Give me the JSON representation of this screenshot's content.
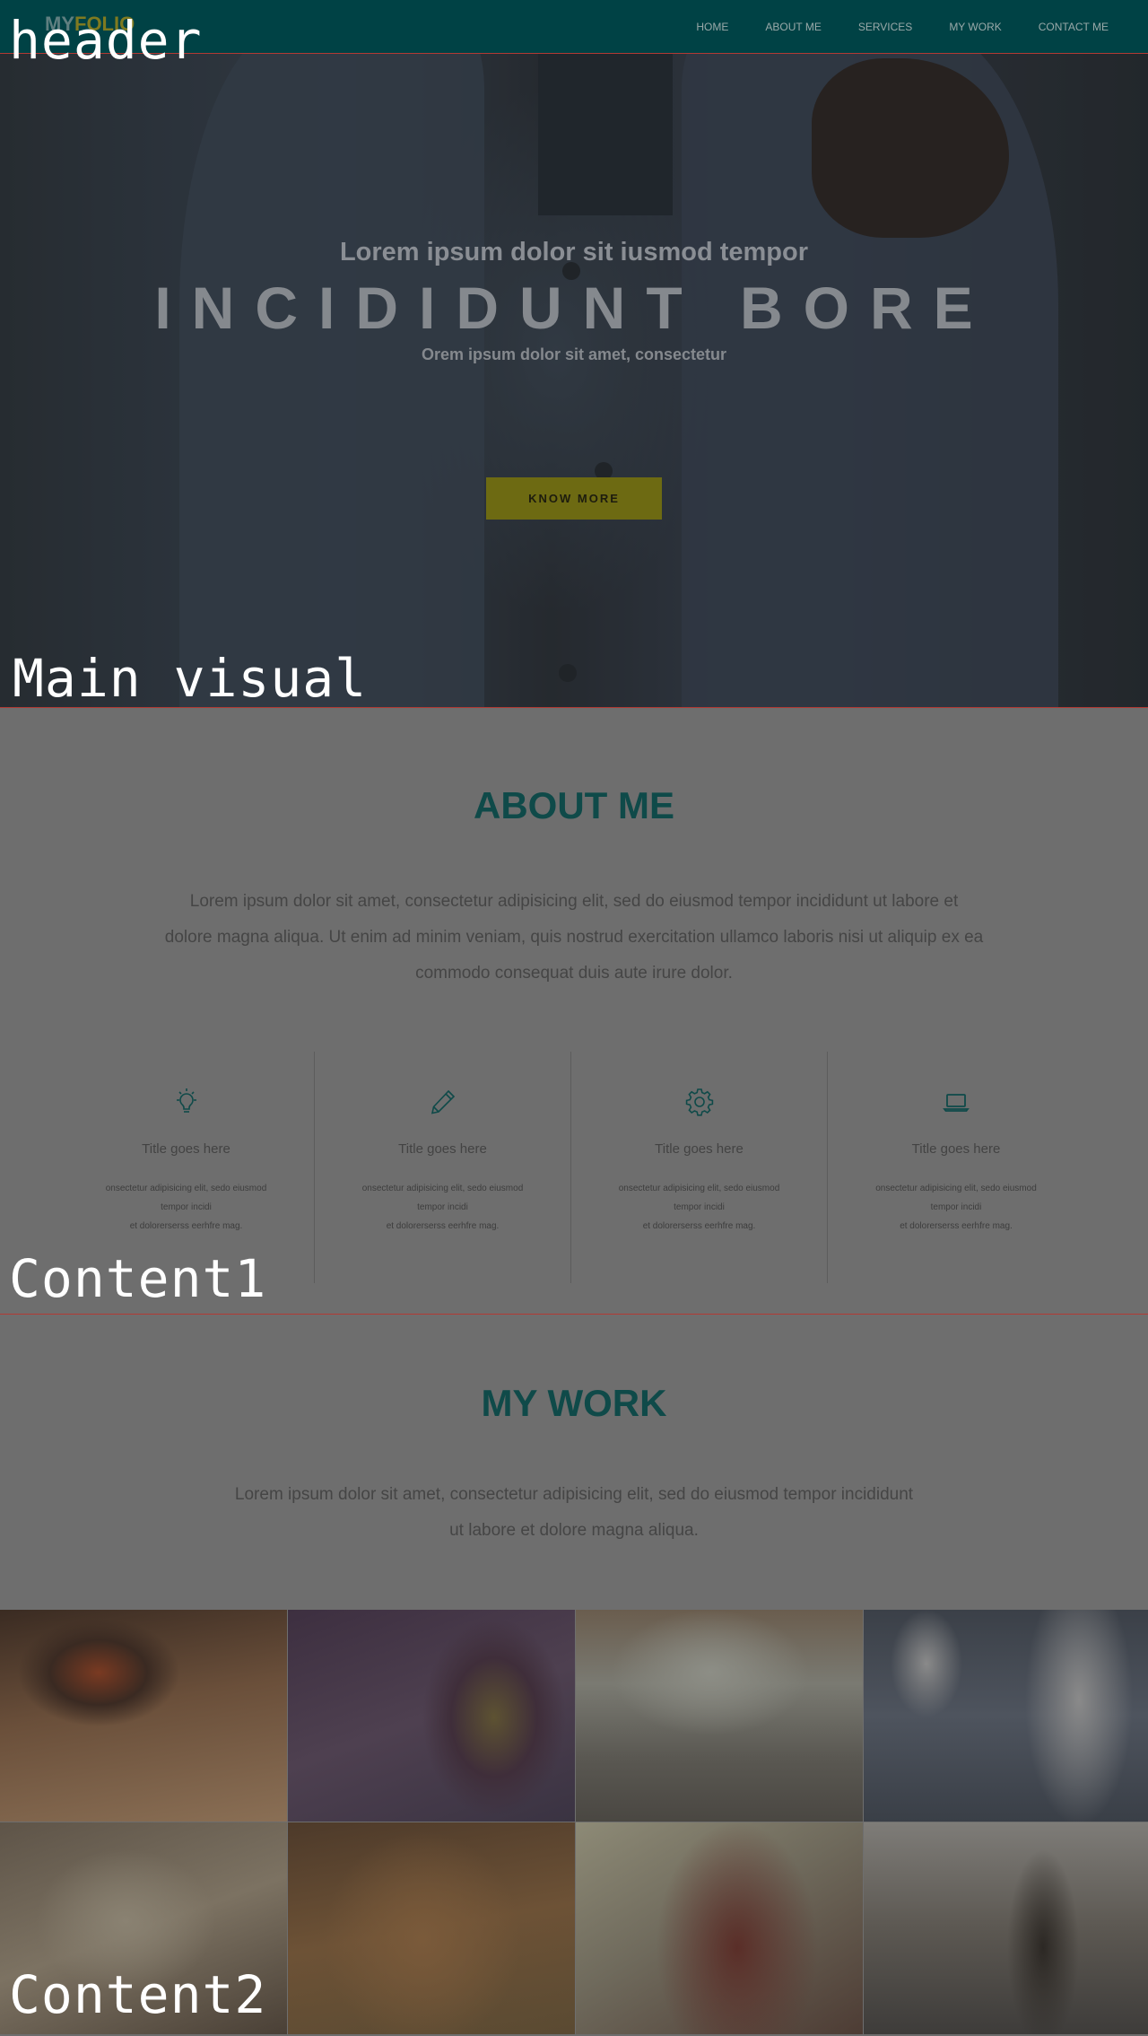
{
  "header": {
    "logo_part1": "MY",
    "logo_part2": "FOLIO",
    "nav": [
      "HOME",
      "ABOUT ME",
      "SERVICES",
      "MY WORK",
      "CONTACT ME"
    ]
  },
  "annotations": {
    "header": "header",
    "main_visual": "Main visual",
    "content1": "Content1",
    "content2": "Content2"
  },
  "hero": {
    "subtitle": "Lorem ipsum dolor sit iusmod tempor",
    "title": "INCIDIDUNT BORE",
    "caption": "Orem ipsum dolor sit amet, consectetur",
    "button_label": "KNOW MORE"
  },
  "about": {
    "title": "ABOUT ME",
    "text_line1": "Lorem ipsum dolor sit amet, consectetur adipisicing elit, sed do eiusmod tempor incididunt ut labore et",
    "text_line2": "dolore magna aliqua. Ut enim ad minim veniam, quis nostrud exercitation ullamco laboris nisi ut aliquip ex ea",
    "text_line3": "commodo consequat duis aute irure dolor.",
    "features": [
      {
        "icon": "lightbulb-icon",
        "title": "Title goes here",
        "desc1": "onsectetur adipisicing elit, sedo eiusmod",
        "desc2": "tempor incidi",
        "desc3": "et dolorerserss eerhfre mag."
      },
      {
        "icon": "pencil-icon",
        "title": "Title goes here",
        "desc1": "onsectetur adipisicing elit, sedo eiusmod",
        "desc2": "tempor incidi",
        "desc3": "et dolorerserss eerhfre mag."
      },
      {
        "icon": "gear-icon",
        "title": "Title goes here",
        "desc1": "onsectetur adipisicing elit, sedo eiusmod",
        "desc2": "tempor incidi",
        "desc3": "et dolorerserss eerhfre mag."
      },
      {
        "icon": "laptop-icon",
        "title": "Title goes here",
        "desc1": "onsectetur adipisicing elit, sedo eiusmod",
        "desc2": "tempor incidi",
        "desc3": "et dolorerserss eerhfre mag."
      }
    ]
  },
  "work": {
    "title": "MY WORK",
    "text_line1": "Lorem ipsum dolor sit amet, consectetur adipisicing elit, sed do eiusmod tempor incididunt",
    "text_line2": "ut labore et dolore magna aliqua."
  },
  "colors": {
    "header_bg": "#004245",
    "accent_teal": "#0f4a49",
    "button_bg": "#6d6a12",
    "divider_red": "#b23a34"
  }
}
